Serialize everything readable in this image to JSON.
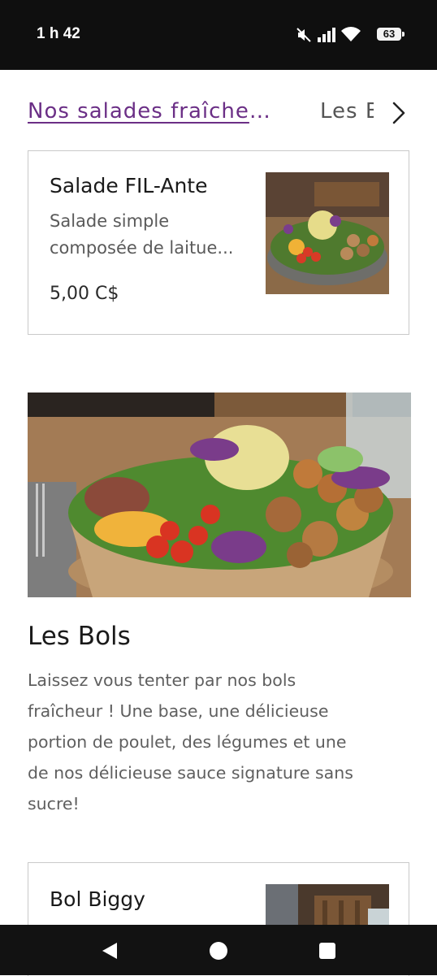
{
  "status_bar": {
    "time": "1 h 42",
    "battery": "63",
    "icons": [
      "mute-icon",
      "signal-icon",
      "wifi-icon",
      "battery-icon"
    ]
  },
  "category_tabs": {
    "active": "Nos salades fraîche...",
    "next": "Les Bols"
  },
  "salad_item": {
    "name": "Salade FIL-Ante",
    "description_lines": [
      "Salade simple",
      "composée de laitue..."
    ],
    "price": "5,00 C$"
  },
  "bols_section": {
    "title": "Les Bols",
    "description_lines": [
      "Laissez vous tenter par nos bols",
      "fraîcheur ! Une base, une délicieuse",
      "portion de poulet, des légumes et une",
      "de nos délicieuse sauce signature sans",
      "sucre!"
    ]
  },
  "bol_item": {
    "name": "Bol Biggy"
  },
  "colors": {
    "accent": "#6b2f86",
    "status_bar": "#0f0f0f",
    "nav_bar": "#121212",
    "card_border": "#c9c9c9"
  },
  "nav_bar": {
    "icons": [
      "back-icon",
      "home-icon",
      "recents-icon"
    ]
  }
}
